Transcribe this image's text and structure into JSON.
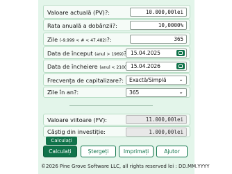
{
  "form": {
    "pv_label": "Valoare actuală (PV)?:",
    "pv_value": "10.000,00lei",
    "rate_label": "Rata anuală a dobânzii?:",
    "rate_value": "10,0000%",
    "days_label_main": "Zile",
    "days_label_range": "(-9.999 < # < 47.482)",
    "days_label_end": "?:",
    "days_value": "365",
    "start_label_main": "Data de început",
    "start_label_range": "(anul > 1969)",
    "start_label_end": "?:",
    "start_value": "15.04.2025",
    "end_label_main": "Data de încheiere",
    "end_label_range": "(anul < 2100)",
    "end_label_end": "?:",
    "end_value": "15.04.2026",
    "freq_label": "Frecvența de capitalizare?:",
    "freq_value": "Exactă/Simplă",
    "daysyear_label": "Zile în an?:",
    "daysyear_value": "365",
    "fv_label": "Valoare viitoare (FV):",
    "fv_value": "11.000,00lei",
    "interest_label": "Câștig din investiție:",
    "interest_value": "1.000,00lei"
  },
  "tooltip": "Calculați",
  "buttons": {
    "calculate": "Calculați",
    "clear": "Ștergeți",
    "print": "Imprimați",
    "help": "Ajutor"
  },
  "footer": "©2026 Pine Grove Software LLC, all rights reserved lei : DD.MM.YYYY",
  "colors": {
    "accent": "#10734a",
    "panel": "#e3f5ea"
  }
}
